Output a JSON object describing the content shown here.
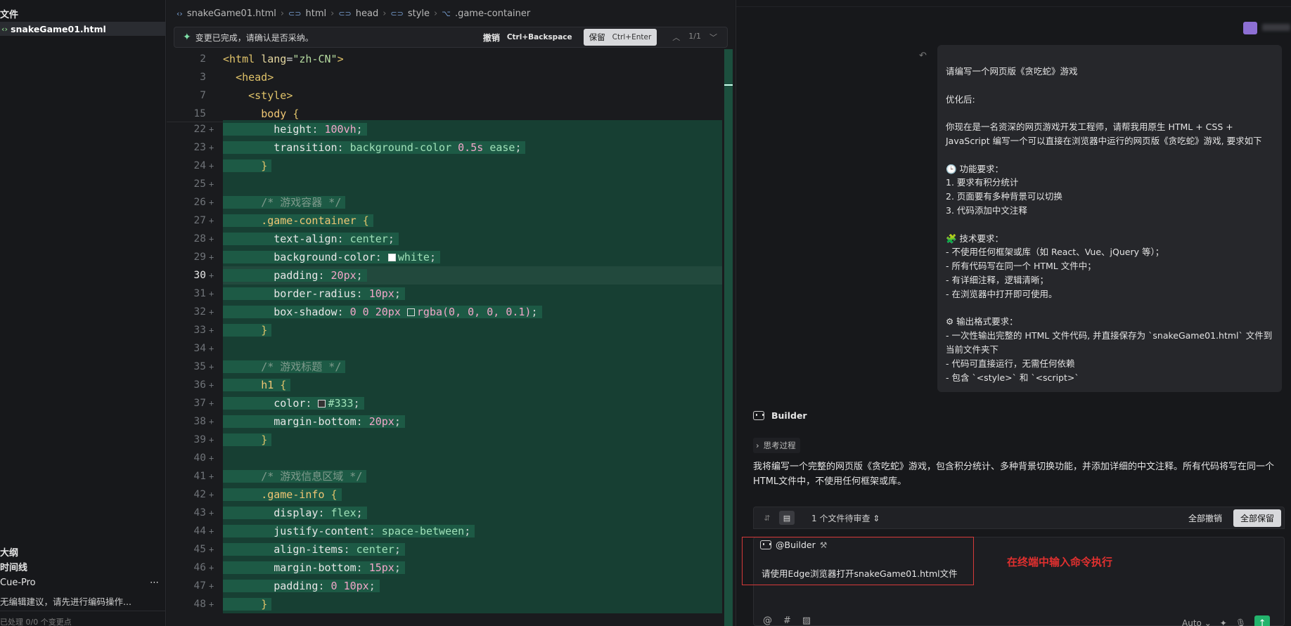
{
  "sidebar": {
    "title": "文件",
    "file": "snakeGame01.html",
    "outline": "大纲",
    "timeline": "时间线",
    "cue_name": "Cue-Pro",
    "cue_more": "⋯",
    "cue_message": "无编辑建议，请先进行编码操作...",
    "status": "已处理 0/0 个变更点"
  },
  "breadcrumb": [
    "snakeGame01.html",
    "html",
    "head",
    "style",
    ".game-container"
  ],
  "review_bar": {
    "message": "变更已完成，请确认是否采纳。",
    "undo_label": "撤销",
    "undo_shortcut": "Ctrl+Backspace",
    "keep_label": "保留",
    "keep_shortcut": "Ctrl+Enter",
    "counter": "1/1"
  },
  "sticky_lines": [
    {
      "n": "2",
      "html": "<span class='t-br'>&lt;</span><span class='t-tag'>html</span> <span class='t-attr'>lang</span>=<span class='t-str'>\"zh-CN\"</span><span class='t-br'>&gt;</span>"
    },
    {
      "n": "3",
      "html": "  <span class='t-br'>&lt;</span><span class='t-tag'>head</span><span class='t-br'>&gt;</span>"
    },
    {
      "n": "7",
      "html": "    <span class='t-br'>&lt;</span><span class='t-tag'>style</span><span class='t-br'>&gt;</span>"
    },
    {
      "n": "15",
      "html": "      <span class='t-sel'>body</span> <span class='t-br'>{</span>"
    }
  ],
  "code_lines": [
    {
      "n": "22",
      "html": "        <span class='t-prop'>height</span>: <span class='t-num'>100vh</span>;"
    },
    {
      "n": "23",
      "html": "        <span class='t-prop'>transition</span>: <span class='t-val'>background-color</span> <span class='t-num'>0.5s</span> <span class='t-val'>ease</span>;"
    },
    {
      "n": "24",
      "html": "      <span class='t-br'>}</span>"
    },
    {
      "n": "25",
      "html": ""
    },
    {
      "n": "26",
      "html": "      <span class='t-com'>/* 游戏容器 */</span>"
    },
    {
      "n": "27",
      "html": "      <span class='t-sel'>.game-container</span> <span class='t-br'>{</span>"
    },
    {
      "n": "28",
      "html": "        <span class='t-prop'>text-align</span>: <span class='t-val'>center</span>;"
    },
    {
      "n": "29",
      "html": "        <span class='t-prop'>background-color</span>: <span class='sw' style='background:#fff'></span><span class='t-val'>white</span>;"
    },
    {
      "n": "30",
      "html": "        <span class='t-prop'>padding</span>: <span class='t-num'>20px</span>;",
      "current": true
    },
    {
      "n": "31",
      "html": "        <span class='t-prop'>border-radius</span>: <span class='t-num'>10px</span>;"
    },
    {
      "n": "32",
      "html": "        <span class='t-prop'>box-shadow</span>: <span class='t-num'>0 0 20px</span> <span class='sw' style='background:transparent'></span><span class='t-num'>rgba(0, 0, 0, 0.1)</span>;"
    },
    {
      "n": "33",
      "html": "      <span class='t-br'>}</span>"
    },
    {
      "n": "34",
      "html": ""
    },
    {
      "n": "35",
      "html": "      <span class='t-com'>/* 游戏标题 */</span>"
    },
    {
      "n": "36",
      "html": "      <span class='t-sel'>h1</span> <span class='t-br'>{</span>"
    },
    {
      "n": "37",
      "html": "        <span class='t-prop'>color</span>: <span class='sw' style='background:#333'></span><span class='t-val'>#333</span>;"
    },
    {
      "n": "38",
      "html": "        <span class='t-prop'>margin-bottom</span>: <span class='t-num'>20px</span>;"
    },
    {
      "n": "39",
      "html": "      <span class='t-br'>}</span>"
    },
    {
      "n": "40",
      "html": ""
    },
    {
      "n": "41",
      "html": "      <span class='t-com'>/* 游戏信息区域 */</span>"
    },
    {
      "n": "42",
      "html": "      <span class='t-sel'>.game-info</span> <span class='t-br'>{</span>"
    },
    {
      "n": "43",
      "html": "        <span class='t-prop'>display</span>: <span class='t-val'>flex</span>;"
    },
    {
      "n": "44",
      "html": "        <span class='t-prop'>justify-content</span>: <span class='t-val'>space-between</span>;"
    },
    {
      "n": "45",
      "html": "        <span class='t-prop'>align-items</span>: <span class='t-val'>center</span>;"
    },
    {
      "n": "46",
      "html": "        <span class='t-prop'>margin-bottom</span>: <span class='t-num'>15px</span>;"
    },
    {
      "n": "47",
      "html": "        <span class='t-prop'>padding</span>: <span class='t-num'>0 10px</span>;"
    },
    {
      "n": "48",
      "html": "      <span class='t-br'>}</span>"
    }
  ],
  "chat": {
    "user_message": "请编写一个网页版《贪吃蛇》游戏\n\n优化后:\n\n你现在是一名资深的网页游戏开发工程师，请帮我用原生 HTML + CSS + JavaScript 编写一个可以直接在浏览器中运行的网页版《贪吃蛇》游戏, 要求如下\n\n🕒 功能要求：\n1. 要求有积分统计\n2. 页面要有多种背景可以切换\n3. 代码添加中文注释\n\n🧩 技术要求：\n- 不使用任何框架或库（如 React、Vue、jQuery 等）；\n- 所有代码写在同一个 HTML 文件中；\n- 有详细注释，逻辑清晰；\n- 在浏览器中打开即可使用。\n\n⚙ 输出格式要求：\n- 一次性输出完整的 HTML 文件代码, 并直接保存为 `snakeGame01.html` 文件到当前文件夹下\n- 代码可直接运行，无需任何依赖\n- 包含 `<style>` 和 `<script>`",
    "builder_name": "Builder",
    "thinking_label": "思考过程",
    "bot_message": "我将编写一个完整的网页版《贪吃蛇》游戏，包含积分统计、多种背景切换功能，并添加详细的中文注释。所有代码将写在同一个HTML文件中，不使用任何框架或库。",
    "pending_files": "1 个文件待审查",
    "undo_all": "全部撤销",
    "keep_all": "全部保留",
    "mention": "@Builder",
    "input_value": "请使用Edge浏览器打开snakeGame01.html文件",
    "annotation": "在终端中输入命令执行",
    "mode": "Auto"
  },
  "colors": {
    "added_line": "#173f33",
    "added_text_bg": "#1d5a45",
    "accent_green": "#23b36c",
    "annotation_red": "#d63a3a"
  }
}
